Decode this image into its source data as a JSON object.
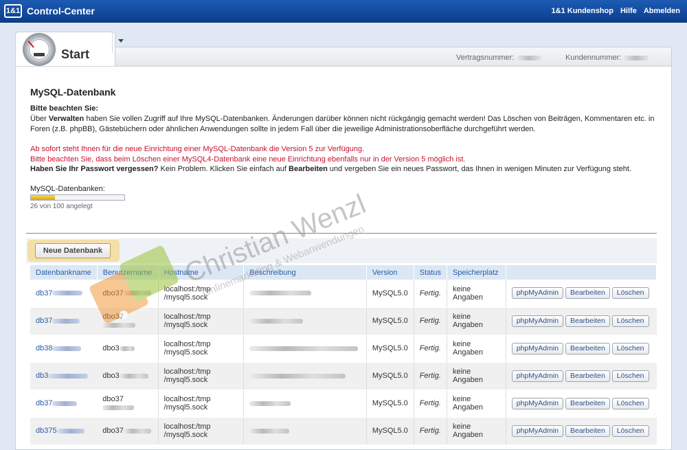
{
  "header": {
    "logo": "1&1",
    "title": "Control-Center",
    "nav": [
      "1&1 Kundenshop",
      "Hilfe",
      "Abmelden"
    ]
  },
  "tab": {
    "label": "Start"
  },
  "meta": {
    "contract_label": "Vertragsnummer:",
    "customer_label": "Kundennummer:"
  },
  "page": {
    "title": "MySQL-Datenbank",
    "notice_heading": "Bitte beachten Sie:",
    "notice_pre": "Über ",
    "notice_bold": "Verwalten",
    "notice_post": " haben Sie vollen Zugriff auf Ihre MySQL-Datenbanken. Änderungen darüber können nicht rückgängig gemacht werden! Das Löschen von Beiträgen, Kommentaren etc. in Foren (z.B. phpBB), Gästebüchern oder ähnlichen Anwendungen sollte in jedem Fall über die jeweilige Administrationsoberfläche durchgeführt werden.",
    "red1": "Ab sofort steht Ihnen für die neue Einrichtung einer MySQL-Datenbank die Version 5 zur Verfügung.",
    "red2": "Bitte beachten Sie, dass beim Löschen einer MySQL4-Datenbank eine neue Einrichtung ebenfalls nur in der Version 5 möglich ist.",
    "pw_bold": "Haben Sie Ihr Passwort vergessen?",
    "pw_mid": " Kein Problem. Klicken Sie einfach auf ",
    "pw_edit": "Bearbeiten",
    "pw_end": " und vergeben Sie ein neues Passwort, das Ihnen in wenigen Minuten zur Verfügung steht."
  },
  "quota": {
    "label": "MySQL-Datenbanken:",
    "used": 26,
    "total": 100,
    "text": "26 von 100 angelegt"
  },
  "toolbar": {
    "new_db": "Neue Datenbank"
  },
  "table": {
    "columns": [
      "Datenbankname",
      "Benutzername",
      "Hostname",
      "Beschreibung",
      "Version",
      "Status",
      "Speicherplatz"
    ],
    "actions": [
      "phpMyAdmin",
      "Bearbeiten",
      "Löschen"
    ],
    "rows": [
      {
        "db": "db37",
        "user": "dbo37",
        "host1": "localhost:/tmp",
        "host2": "/mysql5.sock",
        "version": "MySQL5.0",
        "status": "Fertig.",
        "space1": "keine",
        "space2": "Angaben"
      },
      {
        "db": "db37",
        "user": "dbo37",
        "host1": "localhost:/tmp",
        "host2": "/mysql5.sock",
        "version": "MySQL5.0",
        "status": "Fertig.",
        "space1": "keine",
        "space2": "Angaben"
      },
      {
        "db": "db38",
        "user": "dbo3",
        "host1": "localhost:/tmp",
        "host2": "/mysql5.sock",
        "version": "MySQL5.0",
        "status": "Fertig.",
        "space1": "keine",
        "space2": "Angaben"
      },
      {
        "db": "db3",
        "user": "dbo3",
        "host1": "localhost:/tmp",
        "host2": "/mysql5.sock",
        "version": "MySQL5.0",
        "status": "Fertig.",
        "space1": "keine",
        "space2": "Angaben"
      },
      {
        "db": "db37",
        "user": "dbo37",
        "host1": "localhost:/tmp",
        "host2": "/mysql5.sock",
        "version": "MySQL5.0",
        "status": "Fertig.",
        "space1": "keine",
        "space2": "Angaben"
      },
      {
        "db": "db375",
        "user": "dbo37",
        "host1": "localhost:/tmp",
        "host2": "/mysql5.sock",
        "version": "MySQL5.0",
        "status": "Fertig.",
        "space1": "keine",
        "space2": "Angaben"
      }
    ]
  },
  "watermark": {
    "name": "Christian Wenzl",
    "tagline": "Onlinemarketing & Webanwendungen"
  }
}
